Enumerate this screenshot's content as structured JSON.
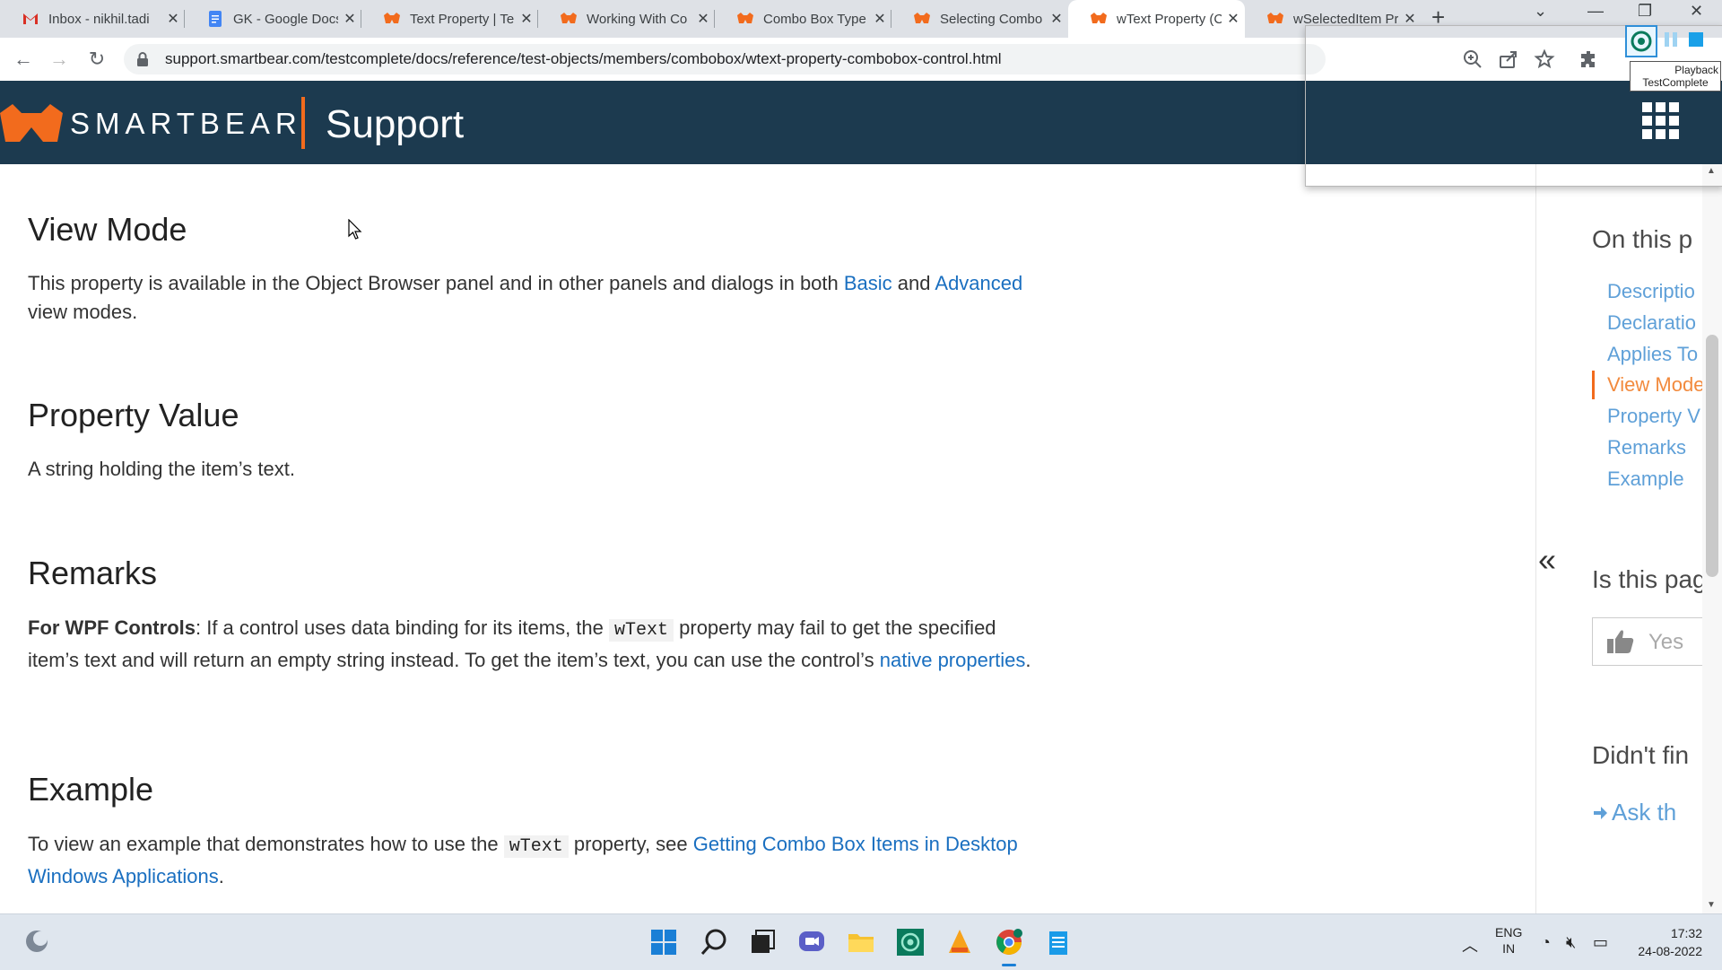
{
  "browser": {
    "tabs": [
      {
        "title": "Inbox - nikhil.tadi",
        "icon": "gmail-icon"
      },
      {
        "title": "GK - Google Docs",
        "icon": "google-docs-icon"
      },
      {
        "title": "Text Property | Te",
        "icon": "smartbear-icon"
      },
      {
        "title": "Working With Co",
        "icon": "smartbear-icon"
      },
      {
        "title": "Combo Box Type",
        "icon": "smartbear-icon"
      },
      {
        "title": "Selecting Combo",
        "icon": "smartbear-icon"
      },
      {
        "title": "wText Property (C",
        "icon": "smartbear-icon",
        "active": true
      },
      {
        "title": "wSelectedItem Pr",
        "icon": "smartbear-icon"
      }
    ],
    "url": "support.smartbear.com/testcomplete/docs/reference/test-objects/members/combobox/wtext-property-combobox-control.html"
  },
  "site_header": {
    "brand": "SMARTBEAR",
    "section": "Support",
    "accent_color": "#f26b1d",
    "background_color": "#1c3a4f"
  },
  "content": {
    "view_mode": {
      "heading": "View Mode",
      "text_before": "This property is available in the Object Browser panel and in other panels and dialogs in both ",
      "link_basic": "Basic",
      "text_mid": " and ",
      "link_advanced": "Advanced",
      "text_after": " view modes."
    },
    "property_value": {
      "heading": "Property Value",
      "text": "A string holding the item’s text."
    },
    "remarks": {
      "heading": "Remarks",
      "bold_label": "For WPF Controls",
      "text_1": ": If a control uses data binding for its items, the ",
      "code": "wText",
      "text_2": " property may fail to get the specified item’s text and will return an empty string instead. To get the item’s text, you can use the control’s ",
      "link": "native properties",
      "text_3": "."
    },
    "example": {
      "heading": "Example",
      "text_1": "To view an example that demonstrates how to use the ",
      "code": "wText",
      "text_2": " property, see ",
      "link": "Getting Combo Box Items in Desktop Windows Applications",
      "text_3": "."
    }
  },
  "right_panel": {
    "on_this_page": "On this p",
    "toc": [
      "Descriptio",
      "Declaratio",
      "Applies To",
      "View Mode",
      "Property V",
      "Remarks",
      "Example"
    ],
    "current_toc_index": 3,
    "is_this_page": "Is this pag",
    "yes_label": "Yes",
    "didnt_find": "Didn't fin",
    "ask_the": "Ask th"
  },
  "testcomplete_overlay": {
    "tooltip_line1": "Playback",
    "tooltip_line2": "TestComplete"
  },
  "taskbar": {
    "items": [
      "start-icon",
      "search-icon",
      "task-view-icon",
      "teams-chat-icon",
      "file-explorer-icon",
      "testcomplete-icon",
      "vlc-icon",
      "chrome-icon",
      "notepad-icon"
    ],
    "lang_line1": "ENG",
    "lang_line2": "IN",
    "time": "17:32",
    "date": "24-08-2022"
  }
}
